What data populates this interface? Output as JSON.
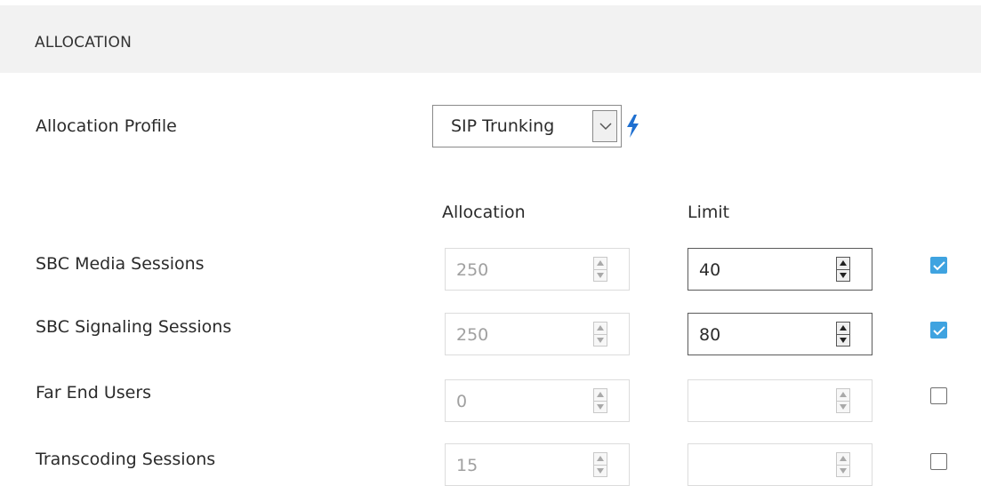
{
  "section": {
    "title": "ALLOCATION"
  },
  "allocation_profile": {
    "label": "Allocation Profile",
    "selected": "SIP Trunking"
  },
  "columns": {
    "allocation": "Allocation",
    "limit": "Limit"
  },
  "rows": [
    {
      "label": "SBC Media Sessions",
      "allocation": "250",
      "limit": "40",
      "checked": true
    },
    {
      "label": "SBC Signaling Sessions",
      "allocation": "250",
      "limit": "80",
      "checked": true
    },
    {
      "label": "Far End Users",
      "allocation": "0",
      "limit": "",
      "checked": false
    },
    {
      "label": "Transcoding Sessions",
      "allocation": "15",
      "limit": "",
      "checked": false
    }
  ],
  "icons": {
    "profile_action": "lightning-bolt-icon"
  },
  "colors": {
    "header_bg": "#f2f2f2",
    "checkbox_checked": "#3fa3e0",
    "bolt": "#1e6fd0"
  }
}
